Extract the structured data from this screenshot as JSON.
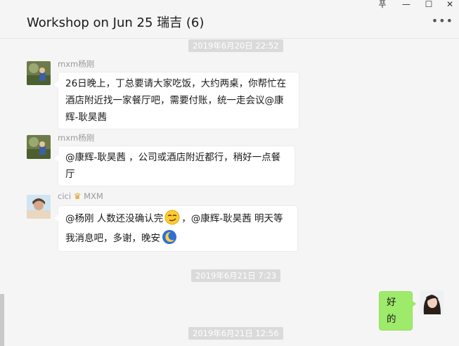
{
  "window": {
    "title": "Workshop on Jun 25 瑞吉 (6)",
    "controls": {
      "pin": "푸",
      "minimize": "—",
      "maximize": "☐",
      "close": "✕"
    },
    "more_icon": "more-dots-icon"
  },
  "timestamps": [
    "2019年6月20日 22:52",
    "2019年6月21日 7:23",
    "2019年6月21日 12:56"
  ],
  "messages": [
    {
      "sender": "mxm杨刚",
      "lines": [
        "26日晚上，丁总要请大家吃饭，大约两桌，你帮忙在",
        "酒店附近找一家餐厅吧，需要付账，统一走会议@康",
        "辉-耿昊茜"
      ]
    },
    {
      "sender": "mxm杨刚",
      "lines": [
        "@康辉-耿昊茜 ，公司或酒店附近都行，稍好一点餐",
        "厅"
      ]
    },
    {
      "sender": "cici",
      "sender_tag": "MXM",
      "line1": "@杨刚 人数还没确认完",
      "line1_after": "，@康辉-耿昊茜 明天等",
      "line2": "我消息吧，多谢，晚安"
    },
    {
      "self": true,
      "text": "好的"
    }
  ],
  "colors": {
    "self_bubble": "#9eea6a",
    "timestamp_bg": "#dadada",
    "background": "#f5f5f5"
  }
}
